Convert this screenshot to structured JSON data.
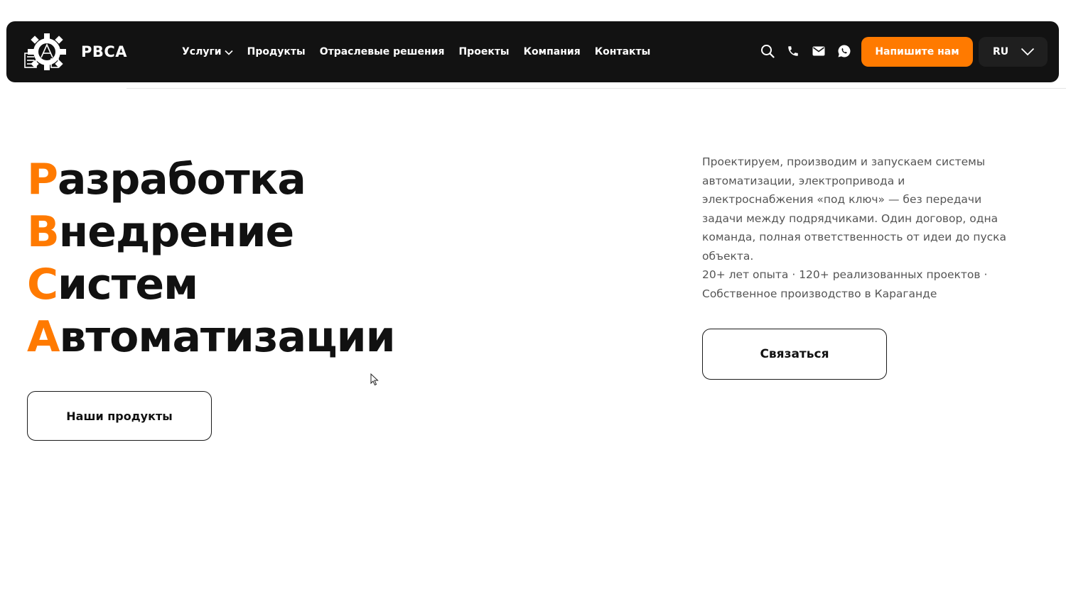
{
  "header": {
    "logo_text": "РВСА",
    "nav": [
      {
        "label": "Услуги",
        "has_dropdown": true
      },
      {
        "label": "Продукты"
      },
      {
        "label": "Отраслевые решения"
      },
      {
        "label": "Проекты"
      },
      {
        "label": "Компания"
      },
      {
        "label": "Контакты"
      }
    ],
    "icons": [
      "search-icon",
      "phone-icon",
      "mail-icon",
      "whatsapp-icon"
    ],
    "cta_label": "Напишите нам",
    "lang_label": "RU"
  },
  "hero": {
    "lines": [
      {
        "accent": "Р",
        "rest": "азработка"
      },
      {
        "accent": "В",
        "rest": "недрение"
      },
      {
        "accent": "С",
        "rest": "истем"
      },
      {
        "accent": "А",
        "rest": "втоматизации"
      }
    ],
    "products_button": "Наши продукты",
    "description": "Проектируем, производим и запускаем системы автоматизации, электропривода и электроснабжения «под ключ» — без передачи задачи между подрядчиками. Один договор, одна команда, полная ответственность от идеи до пуска объекта.",
    "stats": "20+ лет опыта · 120+ реализованных проектов · Собственное производство в Караганде",
    "contact_button": "Связаться"
  },
  "colors": {
    "accent": "#ff7a00",
    "header_bg": "#121212",
    "text_dark": "#111111",
    "text_muted": "#555555"
  }
}
